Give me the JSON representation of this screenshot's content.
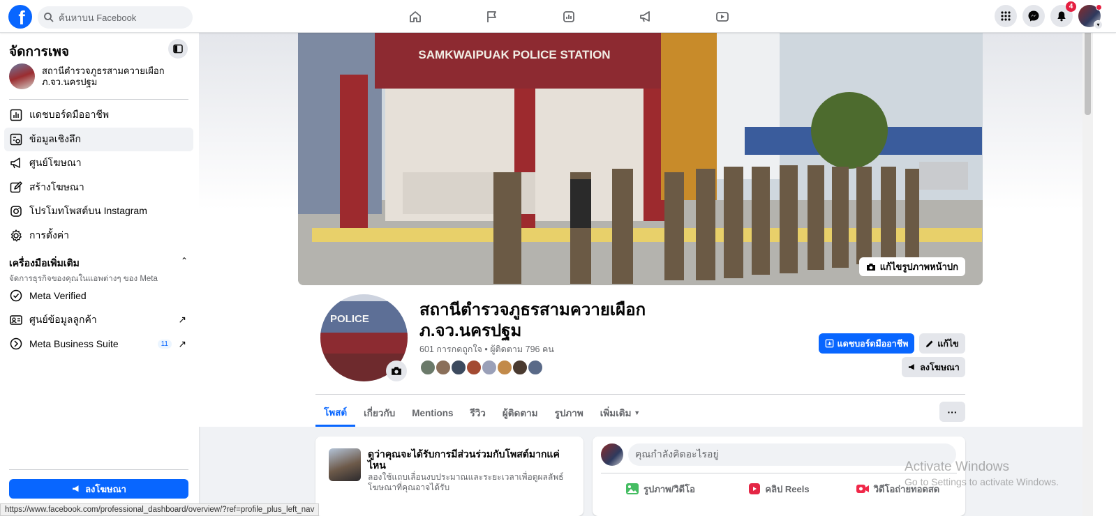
{
  "topbar": {
    "logo": "f",
    "search_placeholder": "ค้นหาบน Facebook",
    "nav_icons": [
      "home-icon",
      "flag-icon",
      "dashboard-icon",
      "megaphone-icon",
      "video-icon"
    ],
    "notifications_count": "4"
  },
  "sidebar": {
    "title": "จัดการเพจ",
    "page_name": "สถานีตำรวจภูธรสามควายเผือก ภ.จว.นครปฐม",
    "items": [
      {
        "label": "แดชบอร์ดมืออาชีพ",
        "icon": "chart-icon"
      },
      {
        "label": "ข้อมูลเชิงลึก",
        "icon": "insights-icon"
      },
      {
        "label": "ศูนย์โฆษณา",
        "icon": "megaphone-icon"
      },
      {
        "label": "สร้างโฆษณา",
        "icon": "pencil-icon"
      },
      {
        "label": "โปรโมทโพสต์บน Instagram",
        "icon": "instagram-icon"
      },
      {
        "label": "การตั้งค่า",
        "icon": "gear-icon"
      }
    ],
    "tools_title": "เครื่องมือเพิ่มเติม",
    "tools_subtitle": "จัดการธุรกิจของคุณในแอพต่างๆ ของ Meta",
    "tools": [
      {
        "label": "Meta Verified",
        "icon": "verified-icon"
      },
      {
        "label": "ศูนย์ข้อมูลลูกค้า",
        "icon": "contact-card-icon"
      },
      {
        "label": "Meta Business Suite",
        "icon": "business-suite-icon",
        "count": "11"
      }
    ],
    "ad_button": "ลงโฆษณา"
  },
  "main": {
    "edit_cover": "แก้ไขรูปภาพหน้าปก",
    "page_title_line1": "สถานีตำรวจภูธรสามควายเผือก",
    "page_title_line2": "ภ.จว.นครปฐม",
    "stats": "601 การกดถูกใจ • ผู้ติดตาม 796 คน",
    "dashboard_button": "แดชบอร์ดมืออาชีพ",
    "edit_button": "แก้ไข",
    "advertise_button": "ลงโฆษณา",
    "tabs": [
      "โพสต์",
      "เกี่ยวกับ",
      "Mentions",
      "รีวิว",
      "ผู้ติดตาม",
      "รูปภาพ",
      "เพิ่มเติม"
    ],
    "more_button": "···",
    "cover_sign": "SAMKWAIPUAK POLICE STATION",
    "profile_sign": "POLICE"
  },
  "engagement_card": {
    "title": "ดูว่าคุณจะได้รับการมีส่วนร่วมกับโพสต์มากแค่ไหน",
    "subtitle": "ลองใช้แถบเลื่อนงบประมาณและระยะเวลาเพื่อดูผลลัพธ์โฆษณาที่คุณอาจได้รับ"
  },
  "composer": {
    "placeholder": "คุณกำลังคิดอะไรอยู่",
    "actions": [
      "รูปภาพ/วิดีโอ",
      "คลิป Reels",
      "วิดีโอถ่ายทอดสด"
    ]
  },
  "status_url": "https://www.facebook.com/professional_dashboard/overview/?ref=profile_plus_left_nav",
  "watermark": {
    "line1": "Activate Windows",
    "line2": "Go to Settings to activate Windows."
  },
  "colors": {
    "brand_blue": "#0866ff",
    "badge_red": "#e41e3f"
  }
}
